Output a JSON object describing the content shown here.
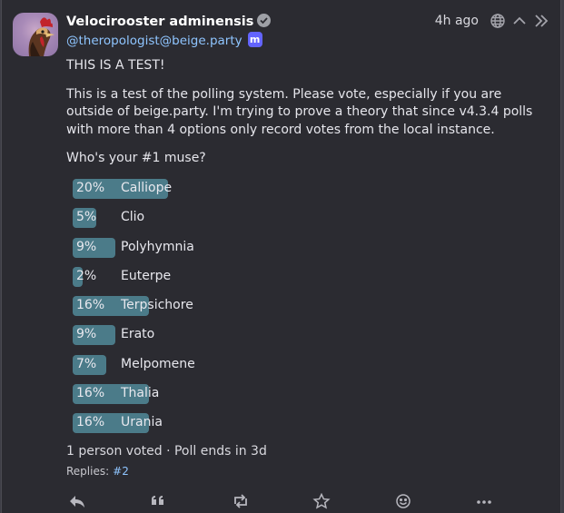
{
  "post": {
    "display_name": "Velocirooster adminensis",
    "handle": "@theropologist@beige.party",
    "instance_badge": "m",
    "time": "4h ago",
    "paragraph1": "THIS IS A TEST!",
    "paragraph2": "This is a test of the polling system. Please vote, especially if you are outside of beige.party. I'm trying to prove a theory that since v4.3.4 polls with more than 4 options only record votes from the local instance.",
    "poll_question": "Who's your #1 muse?"
  },
  "poll": {
    "options": [
      {
        "label": "Calliope",
        "percent_text": "20%",
        "percent": 20
      },
      {
        "label": "Clio",
        "percent_text": "5%",
        "percent": 5
      },
      {
        "label": "Polyhymnia",
        "percent_text": "9%",
        "percent": 9
      },
      {
        "label": "Euterpe",
        "percent_text": "2%",
        "percent": 2
      },
      {
        "label": "Terpsichore",
        "percent_text": "16%",
        "percent": 16
      },
      {
        "label": "Erato",
        "percent_text": "9%",
        "percent": 9
      },
      {
        "label": "Melpomene",
        "percent_text": "7%",
        "percent": 7
      },
      {
        "label": "Thalia",
        "percent_text": "16%",
        "percent": 16
      },
      {
        "label": "Urania",
        "percent_text": "16%",
        "percent": 16
      }
    ],
    "footer": "1 person voted · Poll ends in 3d"
  },
  "replies": {
    "label": "Replies:",
    "link": "#2"
  },
  "colors": {
    "background": "#2b2b31",
    "accent": "#8fc5ff",
    "poll_bar": "#4b7b89",
    "mastodon_badge": "#6364ff"
  },
  "icons": [
    "verified-icon",
    "globe-icon",
    "chevron-up-icon",
    "double-chevron-right-icon",
    "reply-icon",
    "quote-icon",
    "boost-icon",
    "star-icon",
    "emoji-icon",
    "more-icon"
  ]
}
